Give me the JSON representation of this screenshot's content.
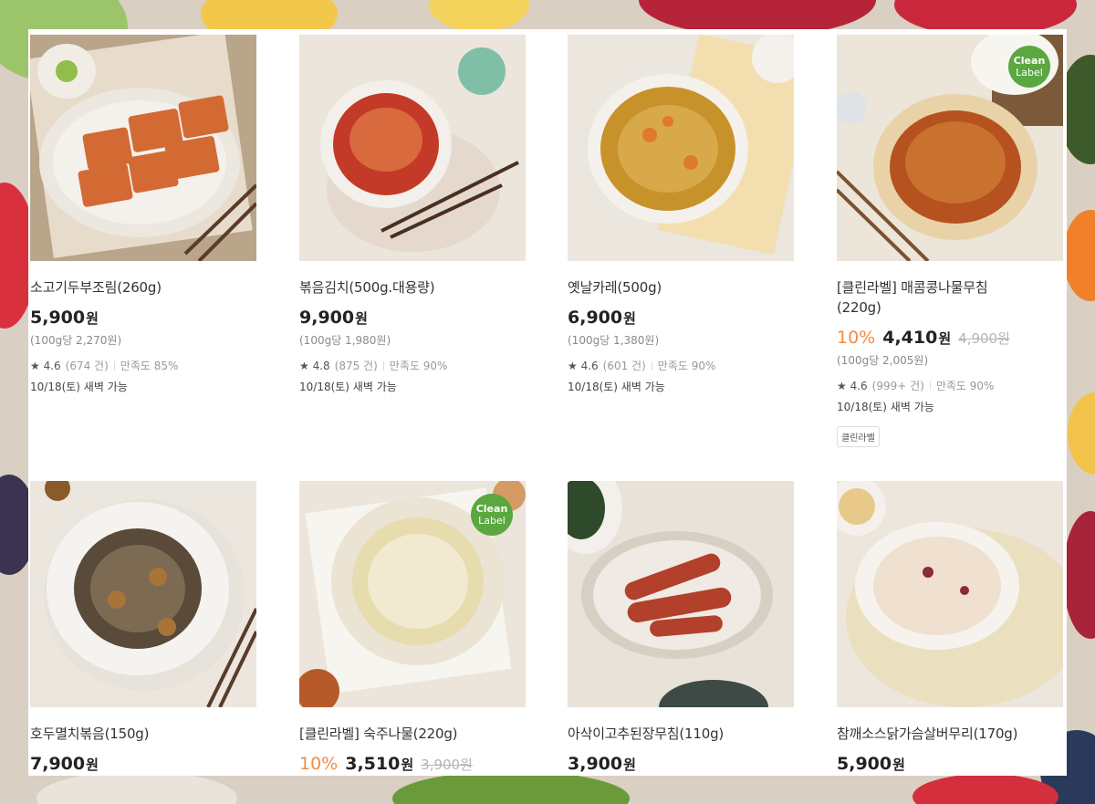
{
  "products": [
    {
      "name": "소고기두부조림(260g)",
      "discount": "",
      "price": "5,900",
      "currency": "원",
      "original": "",
      "unit_price": "(100g당 2,270원)",
      "rating": "★ 4.6",
      "reviews": "(674 건)",
      "satisfaction": "만족도 85%",
      "delivery": "10/18(토) 새벽 가능",
      "tag": "",
      "badge": false
    },
    {
      "name": "볶음김치(500g.대용량)",
      "discount": "",
      "price": "9,900",
      "currency": "원",
      "original": "",
      "unit_price": "(100g당 1,980원)",
      "rating": "★ 4.8",
      "reviews": "(875 건)",
      "satisfaction": "만족도 90%",
      "delivery": "10/18(토) 새벽 가능",
      "tag": "",
      "badge": false
    },
    {
      "name": "옛날카레(500g)",
      "discount": "",
      "price": "6,900",
      "currency": "원",
      "original": "",
      "unit_price": "(100g당 1,380원)",
      "rating": "★ 4.6",
      "reviews": "(601 건)",
      "satisfaction": "만족도 90%",
      "delivery": "10/18(토) 새벽 가능",
      "tag": "",
      "badge": false
    },
    {
      "name": "[클린라벨] 매콤콩나물무침 (220g)",
      "discount": "10%",
      "price": "4,410",
      "currency": "원",
      "original": "4,900원",
      "unit_price": "(100g당 2,005원)",
      "rating": "★ 4.6",
      "reviews": "(999+ 건)",
      "satisfaction": "만족도 90%",
      "delivery": "10/18(토) 새벽 가능",
      "tag": "클린라벨",
      "badge": true
    },
    {
      "name": "호두멸치볶음(150g)",
      "discount": "",
      "price": "7,900",
      "currency": "원",
      "original": "",
      "unit_price": "",
      "rating": "",
      "reviews": "",
      "satisfaction": "",
      "delivery": "",
      "tag": "",
      "badge": false
    },
    {
      "name": "[클린라벨] 숙주나물(220g)",
      "discount": "10%",
      "price": "3,510",
      "currency": "원",
      "original": "3,900원",
      "unit_price": "",
      "rating": "",
      "reviews": "",
      "satisfaction": "",
      "delivery": "",
      "tag": "",
      "badge": true
    },
    {
      "name": "아삭이고추된장무침(110g)",
      "discount": "",
      "price": "3,900",
      "currency": "원",
      "original": "",
      "unit_price": "",
      "rating": "",
      "reviews": "",
      "satisfaction": "",
      "delivery": "",
      "tag": "",
      "badge": false
    },
    {
      "name": "참깨소스닭가슴살버무리(170g)",
      "discount": "",
      "price": "5,900",
      "currency": "원",
      "original": "",
      "unit_price": "",
      "rating": "",
      "reviews": "",
      "satisfaction": "",
      "delivery": "",
      "tag": "",
      "badge": false
    }
  ],
  "badge_text": {
    "line1": "Clean",
    "line2": "Label"
  },
  "colors": {
    "discount": "#f18c42",
    "badge": "#5aa83f",
    "price": "#222222"
  }
}
